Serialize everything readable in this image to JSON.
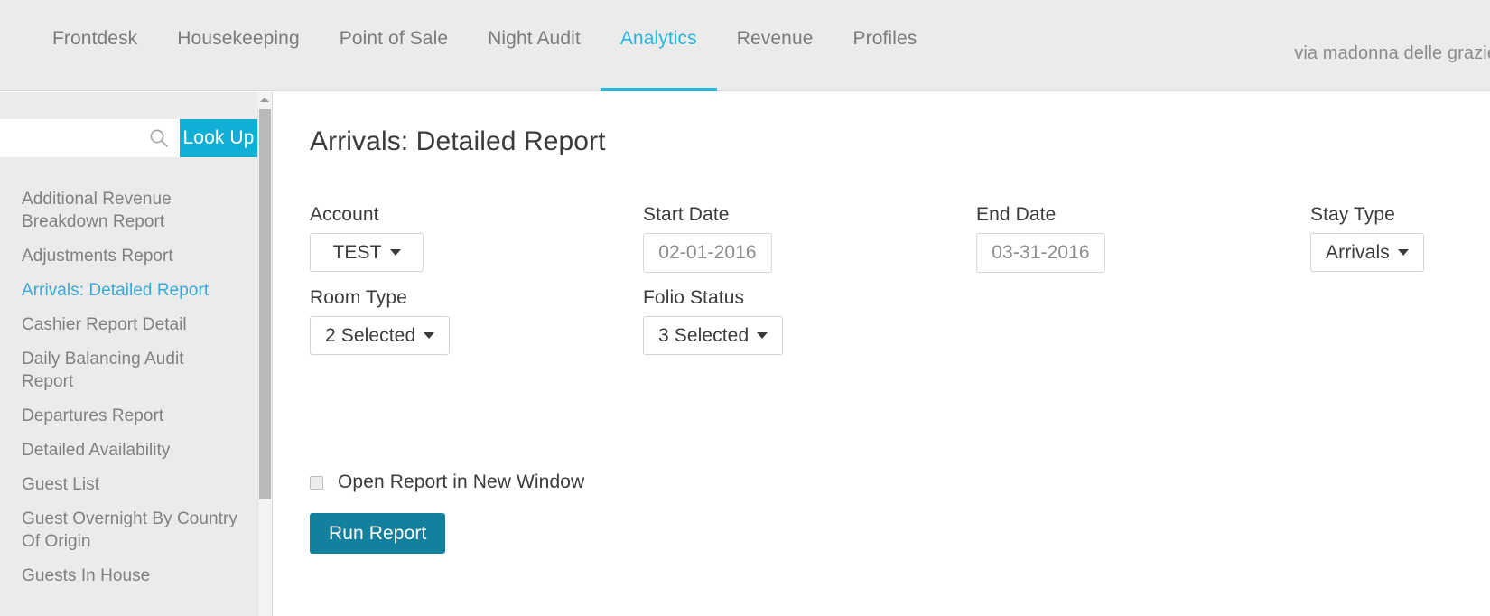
{
  "topnav": {
    "items": [
      {
        "label": "Frontdesk",
        "active": false
      },
      {
        "label": "Housekeeping",
        "active": false
      },
      {
        "label": "Point of Sale",
        "active": false
      },
      {
        "label": "Night Audit",
        "active": false
      },
      {
        "label": "Analytics",
        "active": true
      },
      {
        "label": "Revenue",
        "active": false
      },
      {
        "label": "Profiles",
        "active": false
      }
    ],
    "brand": "via madonna delle grazie",
    "accent_color": "#26b6dd"
  },
  "sidebar": {
    "search": {
      "value": "",
      "placeholder": "",
      "icon": "search-icon",
      "button_label": "Look Up",
      "button_color": "#11afd5"
    },
    "items": [
      {
        "label": "Additional Revenue Breakdown Report",
        "active": false
      },
      {
        "label": "Adjustments Report",
        "active": false
      },
      {
        "label": "Arrivals: Detailed Report",
        "active": true
      },
      {
        "label": "Cashier Report Detail",
        "active": false
      },
      {
        "label": "Daily Balancing Audit Report",
        "active": false
      },
      {
        "label": "Departures Report",
        "active": false
      },
      {
        "label": "Detailed Availability",
        "active": false
      },
      {
        "label": "Guest List",
        "active": false
      },
      {
        "label": "Guest Overnight By Country Of Origin",
        "active": false
      },
      {
        "label": "Guests In House",
        "active": false
      }
    ]
  },
  "main": {
    "title": "Arrivals: Detailed Report",
    "fields": {
      "account": {
        "label": "Account",
        "value": "TEST"
      },
      "start_date": {
        "label": "Start Date",
        "value": "02-01-2016",
        "placeholder": "02-01-2016"
      },
      "end_date": {
        "label": "End Date",
        "value": "03-31-2016",
        "placeholder": "03-31-2016"
      },
      "stay_type": {
        "label": "Stay Type",
        "value": "Arrivals"
      },
      "room_type": {
        "label": "Room Type",
        "value": "2 Selected"
      },
      "folio_status": {
        "label": "Folio Status",
        "value": "3 Selected"
      }
    },
    "open_new_window": {
      "label": "Open Report in New Window",
      "checked": false
    },
    "run_button": {
      "label": "Run Report",
      "color": "#13809d"
    }
  }
}
